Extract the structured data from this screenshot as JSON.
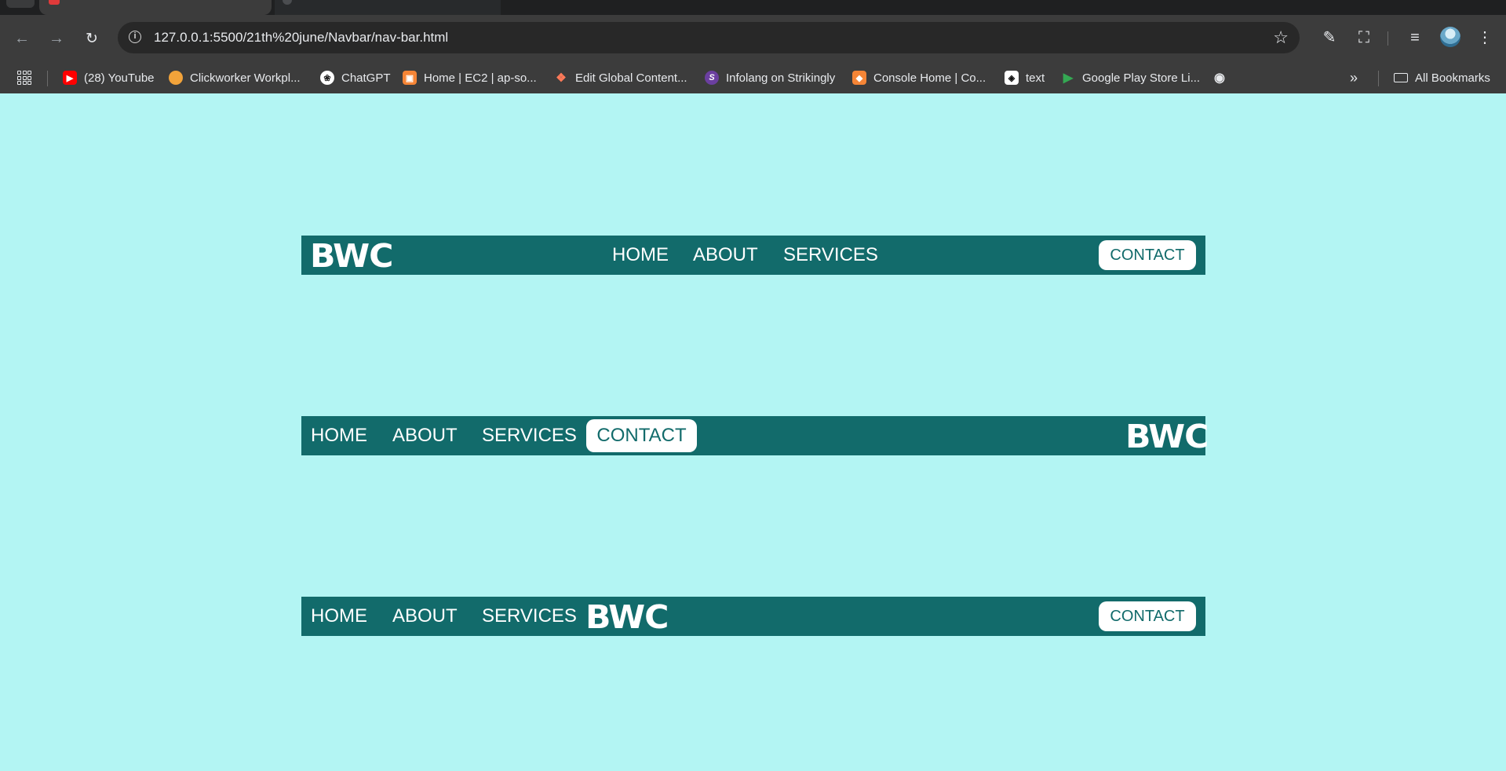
{
  "browser": {
    "url": "127.0.0.1:5500/21th%20june/Navbar/nav-bar.html",
    "bookmarks": [
      {
        "label": "(28) YouTube",
        "icon": "youtube-icon",
        "color": "#ff0000"
      },
      {
        "label": "Clickworker Workpl...",
        "icon": "clickworker-icon",
        "color": "#f2a33a"
      },
      {
        "label": "ChatGPT",
        "icon": "chatgpt-icon",
        "color": "#ffffff"
      },
      {
        "label": "Home | EC2 | ap-so...",
        "icon": "aws-ec2-icon",
        "color": "#f58536"
      },
      {
        "label": "Edit Global Content...",
        "icon": "hubspot-icon",
        "color": "#ff7a59"
      },
      {
        "label": "Infolang on Strikingly",
        "icon": "strikingly-icon",
        "color": "#6b3fa0"
      },
      {
        "label": "Console Home | Co...",
        "icon": "aws-console-icon",
        "color": "#f58536"
      },
      {
        "label": "text",
        "icon": "codepen-icon",
        "color": "#ffffff"
      },
      {
        "label": "Google Play Store Li...",
        "icon": "google-play-icon",
        "color": "#34a853"
      }
    ],
    "all_bookmarks_label": "All Bookmarks"
  },
  "navbars": [
    {
      "logo": "BWC",
      "links": [
        "HOME",
        "ABOUT",
        "SERVICES"
      ],
      "contact": "CONTACT"
    },
    {
      "links": [
        "HOME",
        "ABOUT",
        "SERVICES"
      ],
      "contact": "CONTACT",
      "logo": "BWC"
    },
    {
      "links": [
        "HOME",
        "ABOUT",
        "SERVICES"
      ],
      "logo": "BWC",
      "contact": "CONTACT"
    }
  ],
  "colors": {
    "page_background": "#b3f5f3",
    "navbar_background": "#126b6b",
    "contact_pill_background": "#ffffff",
    "contact_pill_text": "#126b6b"
  }
}
